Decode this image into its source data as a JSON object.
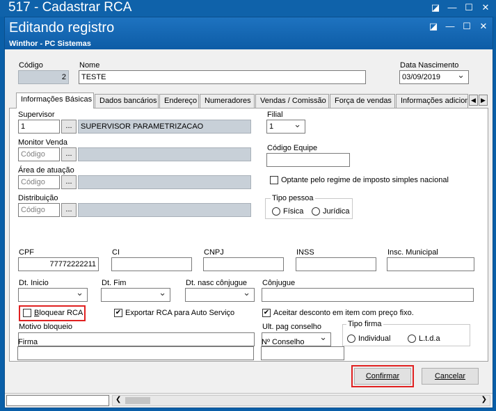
{
  "outer_window": {
    "title": "517 - Cadastrar RCA"
  },
  "dialog": {
    "title": "Editando registro",
    "subtitle": "Winthor - PC Sistemas"
  },
  "header": {
    "codigo_label": "Código",
    "codigo_value": "2",
    "nome_label": "Nome",
    "nome_value": "TESTE",
    "data_nasc_label": "Data Nascimento",
    "data_nasc_value": "03/09/2019"
  },
  "tabs": [
    {
      "label": "Informações Básicas",
      "active": true
    },
    {
      "label": "Dados bancários"
    },
    {
      "label": "Endereço"
    },
    {
      "label": "Numeradores"
    },
    {
      "label": "Vendas  / Comissão"
    },
    {
      "label": "Força de vendas"
    },
    {
      "label": "Informações adicion"
    }
  ],
  "form": {
    "supervisor_label": "Supervisor",
    "supervisor_code": "1",
    "supervisor_name": "SUPERVISOR PARAMETRIZACAO",
    "monitor_label": "Monitor Venda",
    "monitor_placeholder": "Código",
    "area_label": "Área de atuação",
    "area_placeholder": "Código",
    "distribuicao_label": "Distribuição",
    "distribuicao_placeholder": "Código",
    "dots": "...",
    "filial_label": "Filial",
    "filial_value": "1",
    "cod_equipe_label": "Código Equipe",
    "optante_label": "Optante pelo regime de imposto simples nacional",
    "tipo_pessoa_label": "Tipo pessoa",
    "fisica_label": "Física",
    "juridica_label": "Jurídica",
    "cpf_label": "CPF",
    "cpf_value": "77772222211",
    "ci_label": "CI",
    "cnpj_label": "CNPJ",
    "inss_label": "INSS",
    "insc_municipal_label": "Insc. Municipal",
    "dt_inicio_label": "Dt. Inicio",
    "dt_fim_label": "Dt. Fim",
    "dt_nasc_conjuge_label": "Dt. nasc cônjugue",
    "conjuge_label": "Cônjugue",
    "bloquear_prefix": "",
    "bloquear_underlined": "B",
    "bloquear_rest": "loquear RCA",
    "exportar_label": "Exportar RCA para Auto Serviço",
    "aceitar_label": "Aceitar desconto em item com preço fixo.",
    "motivo_label": "Motivo bloqueio",
    "ult_pag_label": "Ult. pag conselho",
    "tipo_firma_label": "Tipo firma",
    "individual_label": "Individual",
    "ltda_label": "L.t.d.a",
    "firma_label": "Firma",
    "n_conselho_label": "Nº Conselho"
  },
  "buttons": {
    "confirmar": "Confirmar",
    "cancelar": "Cancelar"
  },
  "colors": {
    "title_bar": "#0f62aa",
    "highlight": "#e02020",
    "readonly": "#c8d0d8"
  }
}
